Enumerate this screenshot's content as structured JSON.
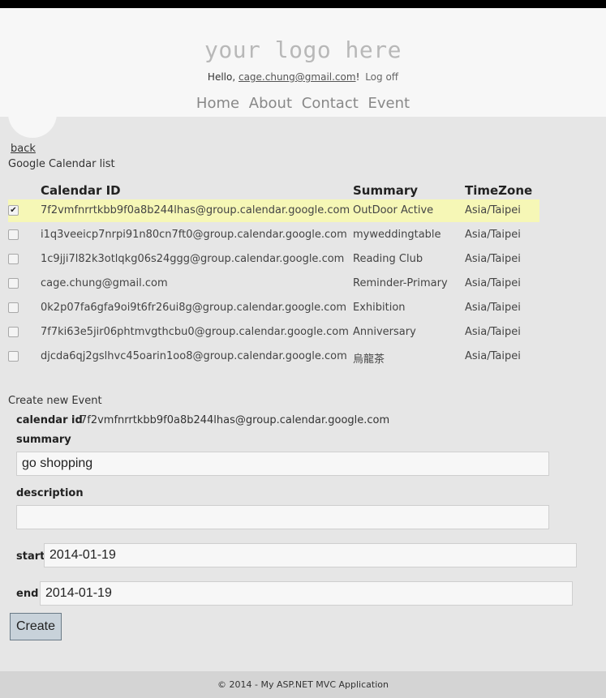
{
  "header": {
    "logo_text": "your logo here",
    "greeting": "Hello,",
    "user_email": "cage.chung@gmail.com",
    "greeting_suffix": "!",
    "logoff": "Log off",
    "nav": [
      "Home",
      "About",
      "Contact",
      "Event"
    ]
  },
  "back_link": "back",
  "list": {
    "title": "Google Calendar list",
    "columns": {
      "id": "Calendar ID",
      "summary": "Summary",
      "timezone": "TimeZone"
    },
    "rows": [
      {
        "checked": true,
        "id": "7f2vmfnrrtkbb9f0a8b244lhas@group.calendar.google.com",
        "summary": "OutDoor Active",
        "timezone": "Asia/Taipei"
      },
      {
        "checked": false,
        "id": "i1q3veeicp7nrpi91n80cn7ft0@group.calendar.google.com",
        "summary": "myweddingtable",
        "timezone": "Asia/Taipei"
      },
      {
        "checked": false,
        "id": "1c9jji7l82k3otlqkg06s24ggg@group.calendar.google.com",
        "summary": "Reading Club",
        "timezone": "Asia/Taipei"
      },
      {
        "checked": false,
        "id": "cage.chung@gmail.com",
        "summary": "Reminder-Primary",
        "timezone": "Asia/Taipei"
      },
      {
        "checked": false,
        "id": "0k2p07fa6gfa9oi9t6fr26ui8g@group.calendar.google.com",
        "summary": "Exhibition",
        "timezone": "Asia/Taipei"
      },
      {
        "checked": false,
        "id": "7f7ki63e5jir06phtmvgthcbu0@group.calendar.google.com",
        "summary": "Anniversary",
        "timezone": "Asia/Taipei"
      },
      {
        "checked": false,
        "id": "djcda6qj2gslhvc45oarin1oo8@group.calendar.google.com",
        "summary": "烏龍茶",
        "timezone": "Asia/Taipei"
      }
    ]
  },
  "form": {
    "title": "Create new Event",
    "calendar_id_label": "calendar id",
    "calendar_id_value": "7f2vmfnrrtkbb9f0a8b244lhas@group.calendar.google.com",
    "summary_label": "summary",
    "summary_value": "go shopping",
    "description_label": "description",
    "description_value": "",
    "start_label": "start",
    "start_value": "2014-01-19",
    "end_label": "end",
    "end_value": "2014-01-19",
    "create_button": "Create"
  },
  "footer": "© 2014 - My ASP.NET MVC Application"
}
